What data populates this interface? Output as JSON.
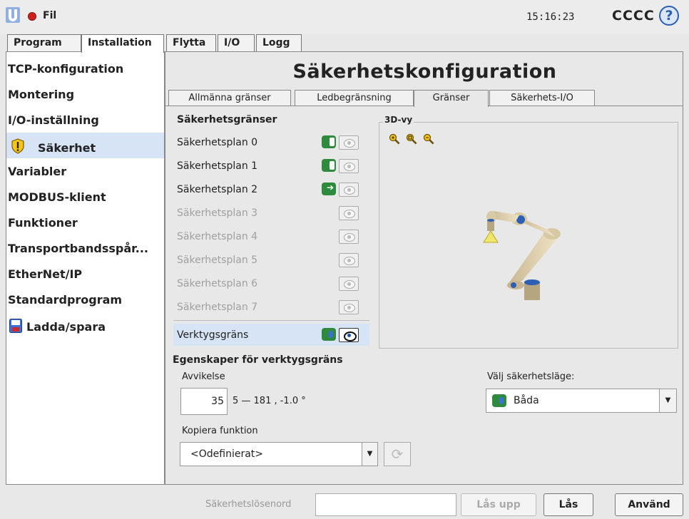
{
  "header": {
    "menu_label": "Fil",
    "time": "15:16:23",
    "robot_name": "CCCC",
    "help_glyph": "?"
  },
  "main_tabs": [
    {
      "label": "Program",
      "active": false
    },
    {
      "label": "Installation",
      "active": true
    },
    {
      "label": "Flytta",
      "active": false
    },
    {
      "label": "I/O",
      "active": false
    },
    {
      "label": "Logg",
      "active": false
    }
  ],
  "sidebar": {
    "items": [
      {
        "label": "TCP-konfiguration"
      },
      {
        "label": "Montering"
      },
      {
        "label": "I/O-inställning"
      },
      {
        "label": "Säkerhet",
        "icon": "warning-shield-icon",
        "selected": true
      },
      {
        "label": "Variabler"
      },
      {
        "label": "MODBUS-klient"
      },
      {
        "label": "Funktioner"
      },
      {
        "label": "Transportbandsspår..."
      },
      {
        "label": "EtherNet/IP"
      },
      {
        "label": "Standardprogram"
      },
      {
        "label": "Ladda/spara",
        "icon": "save-disk-icon"
      }
    ]
  },
  "page": {
    "title": "Säkerhetskonfiguration",
    "subtabs": [
      {
        "label": "Allmänna gränser",
        "active": false
      },
      {
        "label": "Ledbegränsning",
        "active": false
      },
      {
        "label": "Gränser",
        "active": true
      },
      {
        "label": "Säkerhets-I/O",
        "active": false
      }
    ]
  },
  "limits": {
    "heading": "Säkerhetsgränser",
    "rows": [
      {
        "label": "Säkerhetsplan 0",
        "toggle": "normal",
        "enabled": true
      },
      {
        "label": "Säkerhetsplan 1",
        "toggle": "normal",
        "enabled": true
      },
      {
        "label": "Säkerhetsplan 2",
        "toggle": "trigger",
        "enabled": true
      },
      {
        "label": "Säkerhetsplan 3",
        "toggle": "none",
        "enabled": false
      },
      {
        "label": "Säkerhetsplan 4",
        "toggle": "none",
        "enabled": false
      },
      {
        "label": "Säkerhetsplan 5",
        "toggle": "none",
        "enabled": false
      },
      {
        "label": "Säkerhetsplan 6",
        "toggle": "none",
        "enabled": false
      },
      {
        "label": "Säkerhetsplan 7",
        "toggle": "none",
        "enabled": false
      }
    ],
    "tool_limit": {
      "label": "Verktygsgräns",
      "toggle": "both",
      "selected": true
    }
  },
  "view3d": {
    "label": "3D-vy",
    "zoom_icons": [
      "zoom-in-icon",
      "zoom-fit-icon",
      "zoom-out-icon"
    ]
  },
  "properties": {
    "heading": "Egenskaper för verktygsgräns",
    "deviation_label": "Avvikelse",
    "deviation_value": "35",
    "deviation_range": "5 — 181 , -1.0 °",
    "mode_label": "Välj säkerhetsläge:",
    "mode_value": "Båda",
    "copy_label": "Kopiera funktion",
    "copy_value": "<Odefinierat>"
  },
  "footer": {
    "password_label": "Säkerhetslösenord",
    "password_value": "",
    "unlock_label": "Lås upp",
    "lock_label": "Lås",
    "apply_label": "Använd"
  },
  "colors": {
    "selection": "#d6e4f5",
    "toggle_green": "#2e8b3e",
    "accent_blue": "#2a5fb0",
    "record_red": "#d0201d"
  }
}
